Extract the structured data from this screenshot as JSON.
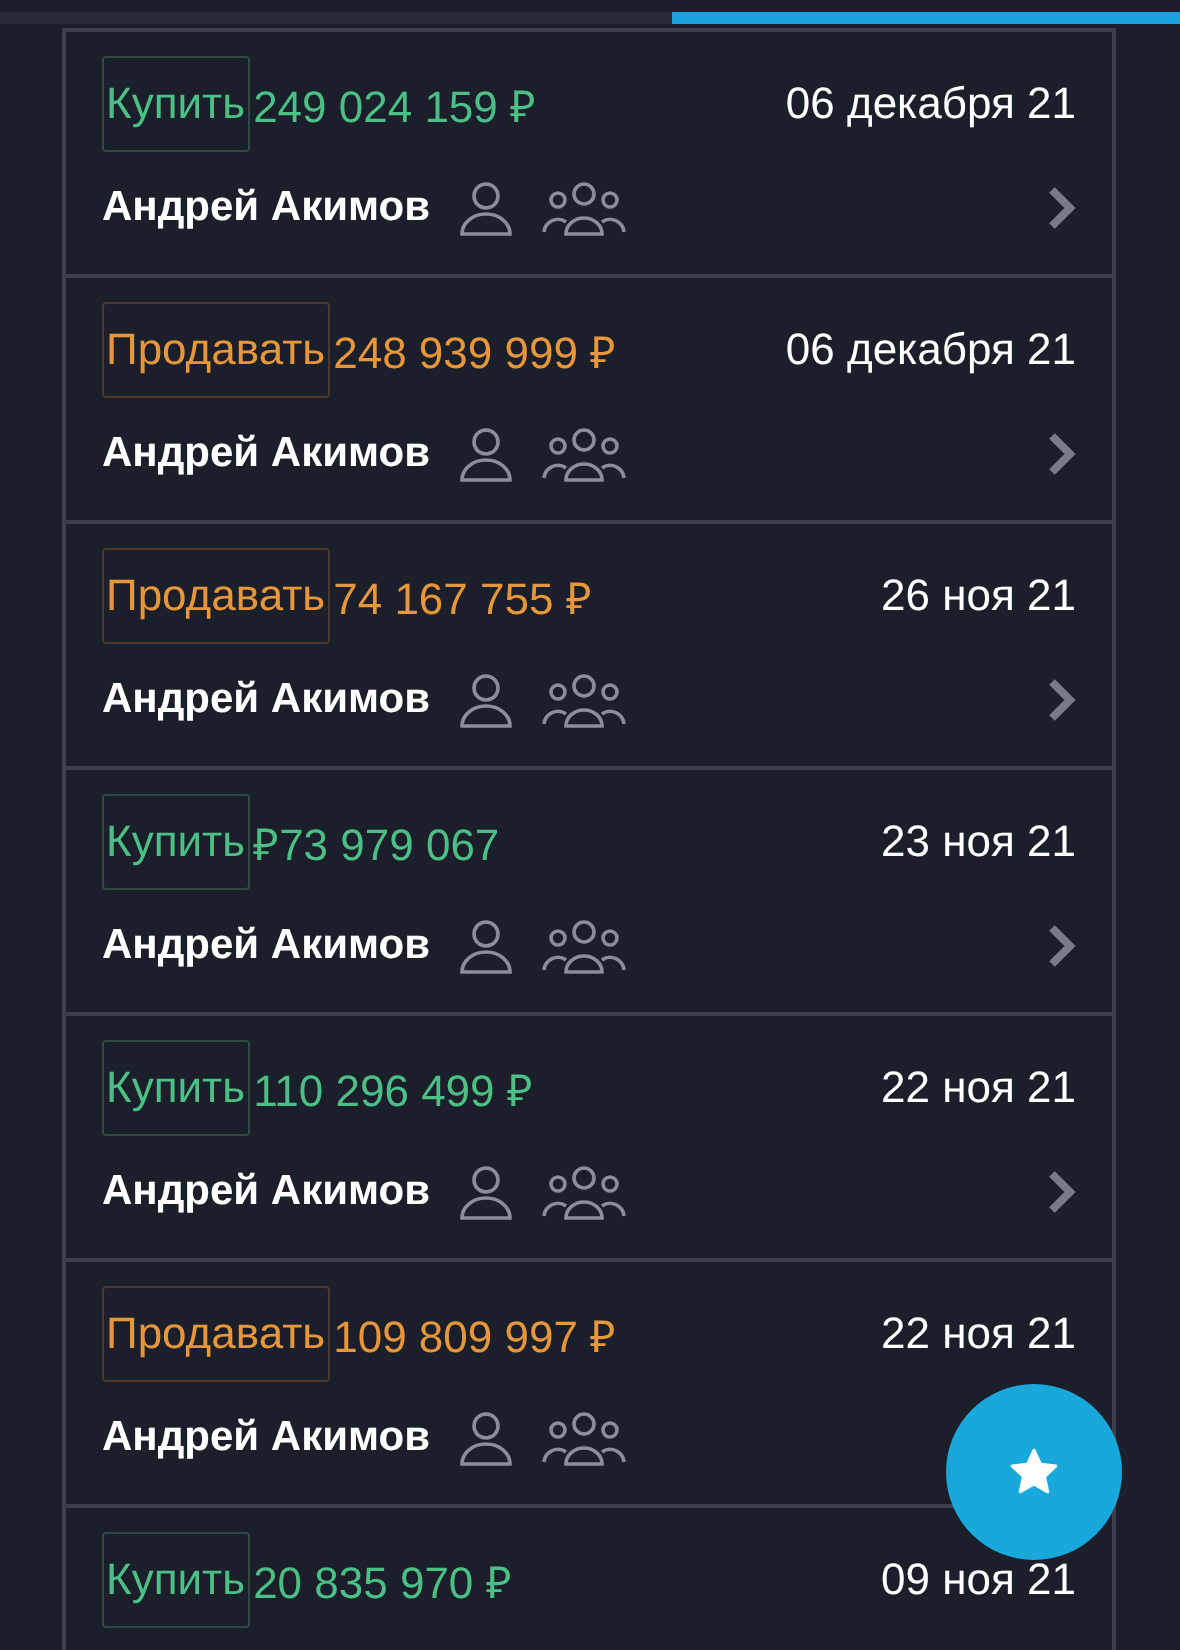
{
  "progress_bar": {
    "level": 0.43
  },
  "deals": [
    {
      "kind": "buy",
      "label": "Купить",
      "amount": "249 024 159 ₽",
      "date": "06 декабря 21",
      "name": "Андрей Акимов",
      "arrow": true
    },
    {
      "kind": "sell",
      "label": "Продавать",
      "amount": "248 939 999 ₽",
      "date": "06 декабря 21",
      "name": "Андрей Акимов",
      "arrow": true
    },
    {
      "kind": "sell",
      "label": "Продавать",
      "amount": "74 167 755 ₽",
      "date": "26 ноя 21",
      "name": "Андрей Акимов",
      "arrow": true
    },
    {
      "kind": "buy",
      "label": "Купить",
      "amount": "₽73 979 067",
      "date": "23 ноя 21",
      "name": "Андрей Акимов",
      "arrow": true
    },
    {
      "kind": "buy",
      "label": "Купить",
      "amount": "110 296 499 ₽",
      "date": "22 ноя 21",
      "name": "Андрей Акимов",
      "arrow": true
    },
    {
      "kind": "sell",
      "label": "Продавать",
      "amount": "109 809 997 ₽",
      "date": "22 ноя 21",
      "name": "Андрей Акимов",
      "arrow": false
    },
    {
      "kind": "buy",
      "label": "Купить",
      "amount": "20 835 970 ₽",
      "date": "09 ноя 21"
    }
  ]
}
